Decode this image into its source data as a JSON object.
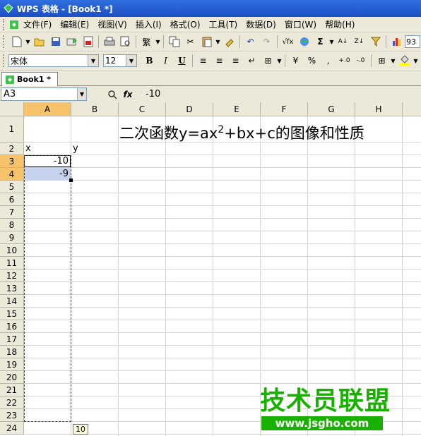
{
  "window": {
    "title": "WPS 表格 - [Book1 *]"
  },
  "menu": [
    "文件(F)",
    "编辑(E)",
    "视图(V)",
    "插入(I)",
    "格式(O)",
    "工具(T)",
    "数据(D)",
    "窗口(W)",
    "帮助(H)"
  ],
  "toolbar": {
    "zoom": "93"
  },
  "format_bar": {
    "font_name": "宋体",
    "font_size": "12",
    "bold": "B",
    "italic": "I",
    "underline": "U",
    "percent": "%"
  },
  "tabs": [
    {
      "label": "Book1 *"
    }
  ],
  "formula_bar": {
    "name_box": "A3",
    "fx_label": "fx",
    "formula": "-10"
  },
  "sheet": {
    "columns": [
      "A",
      "B",
      "C",
      "D",
      "E",
      "F",
      "G",
      "H"
    ],
    "rows": [
      "1",
      "2",
      "3",
      "4",
      "5",
      "6",
      "7",
      "8",
      "9",
      "10",
      "11",
      "12",
      "13",
      "14",
      "15",
      "16",
      "17",
      "18",
      "19",
      "20",
      "21",
      "22",
      "23",
      "24"
    ],
    "selected_column": "A",
    "selected_rows": [
      "3",
      "4"
    ],
    "title": {
      "prefix": "二次函数y=ax",
      "superscript": "2",
      "suffix": "+bx+c的图像和性质"
    },
    "cells": [
      {
        "ref": "A2",
        "value": "x"
      },
      {
        "ref": "B2",
        "value": "y"
      },
      {
        "ref": "A3",
        "value": "-10"
      },
      {
        "ref": "A4",
        "value": "-9"
      }
    ],
    "fill_tooltip": "10"
  },
  "watermark": {
    "text": "技术员联盟",
    "url": "www.jsgho.com",
    "color": "#19b100"
  }
}
